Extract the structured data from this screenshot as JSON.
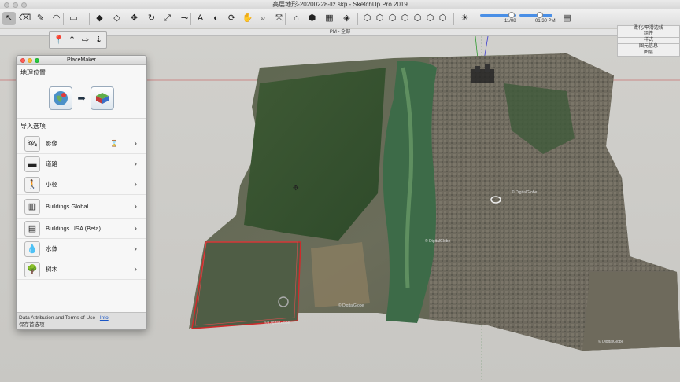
{
  "window": {
    "title": "高层地形-20200228-llz.skp - SketchUp Pro 2019"
  },
  "toolbar": {
    "tools": [
      {
        "name": "select-tool-icon",
        "glyph": "↖"
      },
      {
        "name": "eraser-tool-icon",
        "glyph": "⌫"
      },
      {
        "name": "pencil-tool-icon",
        "glyph": "✎"
      },
      {
        "name": "arc-tool-icon",
        "glyph": "◠"
      },
      {
        "name": "rectangle-tool-icon",
        "glyph": "▭"
      },
      {
        "name": "push-pull-tool-icon",
        "glyph": "◆"
      },
      {
        "name": "offset-tool-icon",
        "glyph": "◇"
      },
      {
        "name": "move-tool-icon",
        "glyph": "✥"
      },
      {
        "name": "rotate-tool-icon",
        "glyph": "↻"
      },
      {
        "name": "scale-tool-icon",
        "glyph": "⤢"
      },
      {
        "name": "tape-measure-icon",
        "glyph": "⊸"
      },
      {
        "name": "text-tool-icon",
        "glyph": "A"
      },
      {
        "name": "paint-bucket-icon",
        "glyph": "◐"
      },
      {
        "name": "orbit-tool-icon",
        "glyph": "⟳"
      },
      {
        "name": "pan-tool-icon",
        "glyph": "✋"
      },
      {
        "name": "zoom-tool-icon",
        "glyph": "⌕"
      },
      {
        "name": "zoom-extents-icon",
        "glyph": "⤧"
      },
      {
        "name": "warehouse-icon",
        "glyph": "⌂"
      },
      {
        "name": "extension-warehouse-icon",
        "glyph": "⬢"
      },
      {
        "name": "layout-icon",
        "glyph": "▦"
      },
      {
        "name": "style-builder-icon",
        "glyph": "◈"
      },
      {
        "name": "iso-view-icon",
        "glyph": "⬡"
      },
      {
        "name": "top-view-icon",
        "glyph": "⬡"
      },
      {
        "name": "front-view-icon",
        "glyph": "⬡"
      },
      {
        "name": "right-view-icon",
        "glyph": "⬡"
      },
      {
        "name": "back-view-icon",
        "glyph": "⬡"
      },
      {
        "name": "left-view-icon",
        "glyph": "⬡"
      },
      {
        "name": "bottom-view-icon",
        "glyph": "⬡"
      },
      {
        "name": "shadows-settings-icon",
        "glyph": "☀"
      },
      {
        "name": "fog-icon",
        "glyph": "▤"
      }
    ],
    "shadow_time": "01:30 PM",
    "shadow_date": "11/08"
  },
  "subtoolbar": {
    "tools": [
      {
        "name": "add-location-icon",
        "glyph": "📍"
      },
      {
        "name": "terrain-toggle-icon",
        "glyph": "↥"
      },
      {
        "name": "photo-texture-icon",
        "glyph": "⇨"
      },
      {
        "name": "import-icon",
        "glyph": "⇣"
      }
    ]
  },
  "scene": {
    "tab_label": "PM - 全部"
  },
  "tray": {
    "items": [
      "柔化/平滑边线",
      "组件",
      "样式",
      "图元信息",
      "图层"
    ]
  },
  "placemaker": {
    "title": "PlaceMaker",
    "geo_section": "地理位置",
    "import_section": "导入选项",
    "options": [
      {
        "label": "影像",
        "icon": "imagery-icon",
        "glyph": "🛰",
        "busy": true
      },
      {
        "label": "道路",
        "icon": "roads-icon",
        "glyph": "▬",
        "busy": false
      },
      {
        "label": "小径",
        "icon": "paths-icon",
        "glyph": "🚶",
        "busy": false
      },
      {
        "label": "Buildings Global",
        "icon": "buildings-global-icon",
        "glyph": "▥",
        "busy": false
      },
      {
        "label": "Buildings USA (Beta)",
        "icon": "buildings-usa-icon",
        "glyph": "▤",
        "busy": false
      },
      {
        "label": "水体",
        "icon": "water-icon",
        "glyph": "💧",
        "busy": false
      },
      {
        "label": "树木",
        "icon": "trees-icon",
        "glyph": "🌳",
        "busy": false
      }
    ],
    "hourglass": "⌛",
    "chevron": "›",
    "footer": {
      "attribution": "Data Attribution and Terms of Use - ",
      "info_link": "Info",
      "save_options": "保存首选项"
    }
  },
  "map": {
    "watermark": "© DigitalGlobe"
  }
}
